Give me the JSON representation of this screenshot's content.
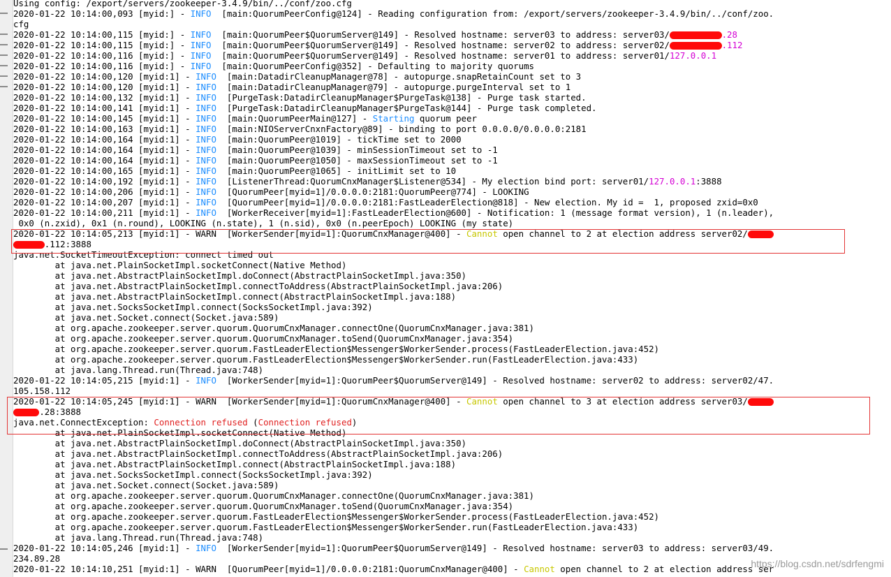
{
  "colors": {
    "info": "#1a8cff",
    "highlight_yellow": "#c7c700",
    "highlight_magenta": "#d400d4",
    "error_red": "#e02020",
    "box_red": "#e33434"
  },
  "terminal": {
    "lines": [
      [
        {
          "t": "Using config: /export/servers/zookeeper-3.4.9/bin/../conf/zoo.cfg"
        }
      ],
      [
        {
          "t": "2020-01-22 10:14:00,093 [myid:] - "
        },
        {
          "t": "INFO",
          "c": "info"
        },
        {
          "t": "  [main:QuorumPeerConfig@124] - Reading configuration from: /export/servers/zookeeper-3.4.9/bin/../conf/zoo."
        }
      ],
      [
        {
          "t": "cfg"
        }
      ],
      [
        {
          "t": "2020-01-22 10:14:00,115 [myid:] - "
        },
        {
          "t": "INFO",
          "c": "info"
        },
        {
          "t": "  [main:QuorumPeer$QuorumServer@149] - Resolved hostname: server03 to address: server03/"
        },
        {
          "t": "xxxxxxxxxx",
          "c": "redact"
        },
        {
          "t": ".28",
          "c": "hl-m"
        }
      ],
      [
        {
          "t": "2020-01-22 10:14:00,115 [myid:] - "
        },
        {
          "t": "INFO",
          "c": "info"
        },
        {
          "t": "  [main:QuorumPeer$QuorumServer@149] - Resolved hostname: server02 to address: server02/"
        },
        {
          "t": "xxxxxxxxxx",
          "c": "redact"
        },
        {
          "t": ".112",
          "c": "hl-m"
        }
      ],
      [
        {
          "t": "2020-01-22 10:14:00,116 [myid:] - "
        },
        {
          "t": "INFO",
          "c": "info"
        },
        {
          "t": "  [main:QuorumPeer$QuorumServer@149] - Resolved hostname: server01 to address: server01/"
        },
        {
          "t": "127.0.0.1",
          "c": "hl-m"
        }
      ],
      [
        {
          "t": "2020-01-22 10:14:00,116 [myid:] - "
        },
        {
          "t": "INFO",
          "c": "info"
        },
        {
          "t": "  [main:QuorumPeerConfig@352] - Defaulting to majority quorums"
        }
      ],
      [
        {
          "t": "2020-01-22 10:14:00,120 [myid:1] - "
        },
        {
          "t": "INFO",
          "c": "info"
        },
        {
          "t": "  [main:DatadirCleanupManager@78] - autopurge.snapRetainCount set to 3"
        }
      ],
      [
        {
          "t": "2020-01-22 10:14:00,120 [myid:1] - "
        },
        {
          "t": "INFO",
          "c": "info"
        },
        {
          "t": "  [main:DatadirCleanupManager@79] - autopurge.purgeInterval set to 1"
        }
      ],
      [
        {
          "t": "2020-01-22 10:14:00,132 [myid:1] - "
        },
        {
          "t": "INFO",
          "c": "info"
        },
        {
          "t": "  [PurgeTask:DatadirCleanupManager$PurgeTask@138] - Purge task started."
        }
      ],
      [
        {
          "t": "2020-01-22 10:14:00,141 [myid:1] - "
        },
        {
          "t": "INFO",
          "c": "info"
        },
        {
          "t": "  [PurgeTask:DatadirCleanupManager$PurgeTask@144] - Purge task completed."
        }
      ],
      [
        {
          "t": "2020-01-22 10:14:00,145 [myid:1] - "
        },
        {
          "t": "INFO",
          "c": "info"
        },
        {
          "t": "  [main:QuorumPeerMain@127] - "
        },
        {
          "t": "Starting",
          "c": "info"
        },
        {
          "t": " quorum peer"
        }
      ],
      [
        {
          "t": "2020-01-22 10:14:00,163 [myid:1] - "
        },
        {
          "t": "INFO",
          "c": "info"
        },
        {
          "t": "  [main:NIOServerCnxnFactory@89] - binding to port 0.0.0.0/0.0.0.0:2181"
        }
      ],
      [
        {
          "t": "2020-01-22 10:14:00,164 [myid:1] - "
        },
        {
          "t": "INFO",
          "c": "info"
        },
        {
          "t": "  [main:QuorumPeer@1019] - tickTime set to 2000"
        }
      ],
      [
        {
          "t": "2020-01-22 10:14:00,164 [myid:1] - "
        },
        {
          "t": "INFO",
          "c": "info"
        },
        {
          "t": "  [main:QuorumPeer@1039] - minSessionTimeout set to -1"
        }
      ],
      [
        {
          "t": "2020-01-22 10:14:00,164 [myid:1] - "
        },
        {
          "t": "INFO",
          "c": "info"
        },
        {
          "t": "  [main:QuorumPeer@1050] - maxSessionTimeout set to -1"
        }
      ],
      [
        {
          "t": "2020-01-22 10:14:00,165 [myid:1] - "
        },
        {
          "t": "INFO",
          "c": "info"
        },
        {
          "t": "  [main:QuorumPeer@1065] - initLimit set to 10"
        }
      ],
      [
        {
          "t": "2020-01-22 10:14:00,192 [myid:1] - "
        },
        {
          "t": "INFO",
          "c": "info"
        },
        {
          "t": "  [ListenerThread:QuorumCnxManager$Listener@534] - My election bind port: server01/"
        },
        {
          "t": "127.0.0.1",
          "c": "hl-m"
        },
        {
          "t": ":3888"
        }
      ],
      [
        {
          "t": "2020-01-22 10:14:00,206 [myid:1] - "
        },
        {
          "t": "INFO",
          "c": "info"
        },
        {
          "t": "  [QuorumPeer[myid=1]/0.0.0.0:2181:QuorumPeer@774] - LOOKING"
        }
      ],
      [
        {
          "t": "2020-01-22 10:14:00,207 [myid:1] - "
        },
        {
          "t": "INFO",
          "c": "info"
        },
        {
          "t": "  [QuorumPeer[myid=1]/0.0.0.0:2181:FastLeaderElection@818] - New election. My id =  1, proposed zxid=0x0"
        }
      ],
      [
        {
          "t": "2020-01-22 10:14:00,211 [myid:1] - "
        },
        {
          "t": "INFO",
          "c": "info"
        },
        {
          "t": "  [WorkerReceiver[myid=1]:FastLeaderElection@600] - Notification: 1 (message format version), 1 (n.leader),"
        }
      ],
      [
        {
          "t": " 0x0 (n.zxid), 0x1 (n.round), LOOKING (n.state), 1 (n.sid), 0x0 (n.peerEpoch) LOOKING (my state)"
        }
      ],
      [
        {
          "t": "2020-01-22 10:14:05,213 [myid:1] - WARN  [WorkerSender[myid=1]:QuorumCnxManager@400] - "
        },
        {
          "t": "Cannot",
          "c": "hl-y"
        },
        {
          "t": " open channel to 2 at election address server02/"
        },
        {
          "t": "xxxxx",
          "c": "redact"
        }
      ],
      [
        {
          "t": "xxxxxx",
          "c": "redact"
        },
        {
          "t": ".112:3888"
        }
      ],
      [
        {
          "t": "java.net.SocketTimeoutException: connect timed out"
        }
      ],
      [
        {
          "t": "        at java.net.PlainSocketImpl.socketConnect(Native Method)"
        }
      ],
      [
        {
          "t": "        at java.net.AbstractPlainSocketImpl.doConnect(AbstractPlainSocketImpl.java:350)"
        }
      ],
      [
        {
          "t": "        at java.net.AbstractPlainSocketImpl.connectToAddress(AbstractPlainSocketImpl.java:206)"
        }
      ],
      [
        {
          "t": "        at java.net.AbstractPlainSocketImpl.connect(AbstractPlainSocketImpl.java:188)"
        }
      ],
      [
        {
          "t": "        at java.net.SocksSocketImpl.connect(SocksSocketImpl.java:392)"
        }
      ],
      [
        {
          "t": "        at java.net.Socket.connect(Socket.java:589)"
        }
      ],
      [
        {
          "t": "        at org.apache.zookeeper.server.quorum.QuorumCnxManager.connectOne(QuorumCnxManager.java:381)"
        }
      ],
      [
        {
          "t": "        at org.apache.zookeeper.server.quorum.QuorumCnxManager.toSend(QuorumCnxManager.java:354)"
        }
      ],
      [
        {
          "t": "        at org.apache.zookeeper.server.quorum.FastLeaderElection$Messenger$WorkerSender.process(FastLeaderElection.java:452)"
        }
      ],
      [
        {
          "t": "        at org.apache.zookeeper.server.quorum.FastLeaderElection$Messenger$WorkerSender.run(FastLeaderElection.java:433)"
        }
      ],
      [
        {
          "t": "        at java.lang.Thread.run(Thread.java:748)"
        }
      ],
      [
        {
          "t": "2020-01-22 10:14:05,215 [myid:1] - "
        },
        {
          "t": "INFO",
          "c": "info"
        },
        {
          "t": "  [WorkerSender[myid=1]:QuorumPeer$QuorumServer@149] - Resolved hostname: server02 to address: server02/47."
        }
      ],
      [
        {
          "t": "105.158.112"
        }
      ],
      [
        {
          "t": "2020-01-22 10:14:05,245 [myid:1] - WARN  [WorkerSender[myid=1]:QuorumCnxManager@400] - "
        },
        {
          "t": "Cannot",
          "c": "hl-y"
        },
        {
          "t": " open channel to 3 at election address server03/"
        },
        {
          "t": "xxxxx",
          "c": "redact"
        }
      ],
      [
        {
          "t": "xxxxx",
          "c": "redact"
        },
        {
          "t": ".28:3888"
        }
      ],
      [
        {
          "t": "java.net.ConnectException: "
        },
        {
          "t": "Connection refused",
          "c": "hl-r"
        },
        {
          "t": " ("
        },
        {
          "t": "Connection refused",
          "c": "hl-r"
        },
        {
          "t": ")"
        }
      ],
      [
        {
          "t": "        at java.net.PlainSocketImpl.socketConnect(Native Method)"
        }
      ],
      [
        {
          "t": "        at java.net.AbstractPlainSocketImpl.doConnect(AbstractPlainSocketImpl.java:350)"
        }
      ],
      [
        {
          "t": "        at java.net.AbstractPlainSocketImpl.connectToAddress(AbstractPlainSocketImpl.java:206)"
        }
      ],
      [
        {
          "t": "        at java.net.AbstractPlainSocketImpl.connect(AbstractPlainSocketImpl.java:188)"
        }
      ],
      [
        {
          "t": "        at java.net.SocksSocketImpl.connect(SocksSocketImpl.java:392)"
        }
      ],
      [
        {
          "t": "        at java.net.Socket.connect(Socket.java:589)"
        }
      ],
      [
        {
          "t": "        at org.apache.zookeeper.server.quorum.QuorumCnxManager.connectOne(QuorumCnxManager.java:381)"
        }
      ],
      [
        {
          "t": "        at org.apache.zookeeper.server.quorum.QuorumCnxManager.toSend(QuorumCnxManager.java:354)"
        }
      ],
      [
        {
          "t": "        at org.apache.zookeeper.server.quorum.FastLeaderElection$Messenger$WorkerSender.process(FastLeaderElection.java:452)"
        }
      ],
      [
        {
          "t": "        at org.apache.zookeeper.server.quorum.FastLeaderElection$Messenger$WorkerSender.run(FastLeaderElection.java:433)"
        }
      ],
      [
        {
          "t": "        at java.lang.Thread.run(Thread.java:748)"
        }
      ],
      [
        {
          "t": "2020-01-22 10:14:05,246 [myid:1] - "
        },
        {
          "t": "INFO",
          "c": "info"
        },
        {
          "t": "  [WorkerSender[myid=1]:QuorumPeer$QuorumServer@149] - Resolved hostname: server03 to address: server03/49."
        }
      ],
      [
        {
          "t": "234.89.28"
        }
      ],
      [
        {
          "t": "2020-01-22 10:14:10,251 [myid:1] - WARN  [QuorumPeer[myid=1]/0.0.0.0:2181:QuorumCnxManager@400] - "
        },
        {
          "t": "Cannot",
          "c": "hl-y"
        },
        {
          "t": " open channel to 2 at election address ser"
        }
      ]
    ]
  },
  "watermark": "https://blog.csdn.net/sdrfengmi"
}
